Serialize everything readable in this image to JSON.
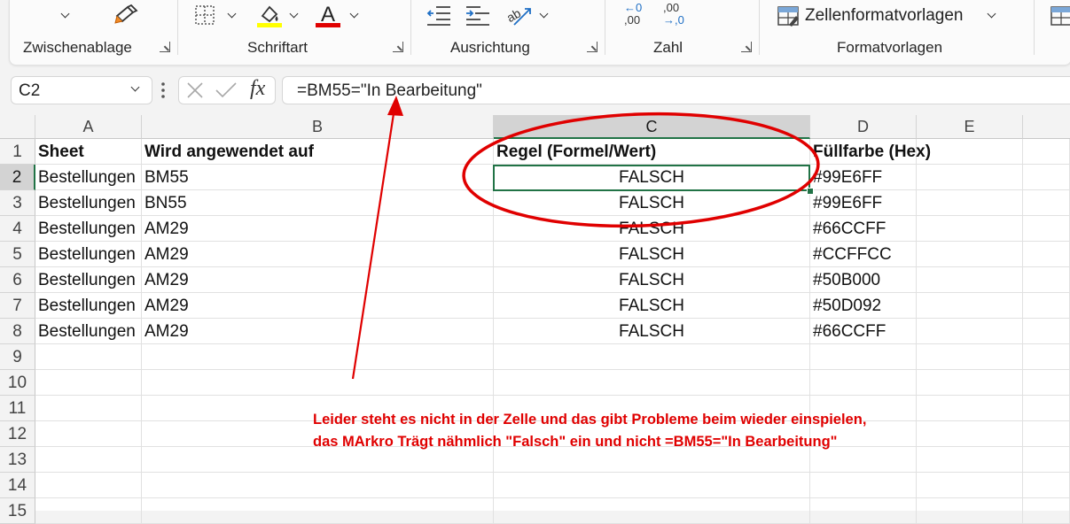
{
  "ribbon": {
    "groups": [
      {
        "label": "Zwischenablage"
      },
      {
        "label": "Schriftart"
      },
      {
        "label": "Ausrichtung"
      },
      {
        "label": "Zahl"
      },
      {
        "label": "Formatvorlagen"
      }
    ],
    "zellenformatvorlagen_label": "Zellenformatvorlagen",
    "accent_fill_color": "#ffff00",
    "accent_font_color": "#e00000",
    "decimal_increase_label": ",00",
    "decimal_decrease_label": ",0",
    "decimal_increase_top": ",00",
    "decimal_decrease_top": ",00",
    "decimal_left_top": "←0",
    "decimal_left_bottom": ",00",
    "decimal_right_top": ",00",
    "decimal_right_bottom": "→,0"
  },
  "formula_bar": {
    "name_box": "C2",
    "formula": "=BM55=\"In Bearbeitung\""
  },
  "columns": [
    "A",
    "B",
    "C",
    "D",
    "E"
  ],
  "rows": [
    "1",
    "2",
    "3",
    "4",
    "5",
    "6",
    "7",
    "8",
    "9",
    "10",
    "11",
    "12",
    "13",
    "14",
    "15"
  ],
  "table": {
    "header": [
      "Sheet",
      "Wird angewendet auf",
      "Regel (Formel/Wert)",
      "Füllfarbe (Hex)"
    ],
    "data": [
      [
        "Bestellungen",
        "BM55",
        "FALSCH",
        "#99E6FF"
      ],
      [
        "Bestellungen",
        "BN55",
        "FALSCH",
        "#99E6FF"
      ],
      [
        "Bestellungen",
        "AM29",
        "FALSCH",
        "#66CCFF"
      ],
      [
        "Bestellungen",
        "AM29",
        "FALSCH",
        "#CCFFCC"
      ],
      [
        "Bestellungen",
        "AM29",
        "FALSCH",
        "#50B000"
      ],
      [
        "Bestellungen",
        "AM29",
        "FALSCH",
        "#50D092"
      ],
      [
        "Bestellungen",
        "AM29",
        "FALSCH",
        "#66CCFF"
      ]
    ]
  },
  "annotation": {
    "line1": "Leider steht es nicht in der Zelle und das gibt Probleme beim wieder einspielen,",
    "line2": "das MArkro Trägt nähmlich \"Falsch\" ein und nicht =BM55=\"In Bearbeitung\"",
    "color": "#e00000"
  }
}
